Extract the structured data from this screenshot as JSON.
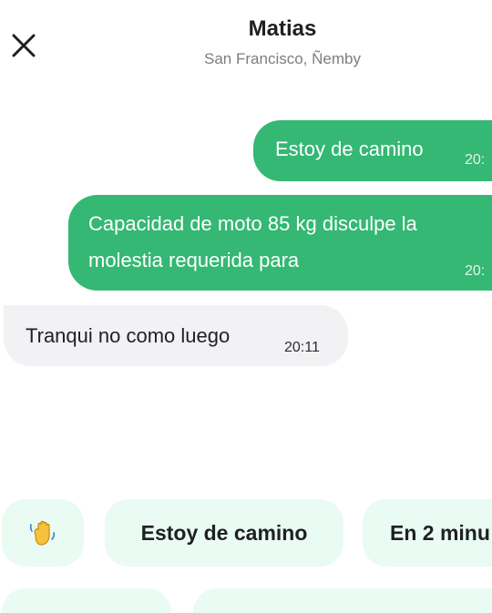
{
  "header": {
    "close_icon": "close-icon",
    "title": "Matias",
    "subtitle": "San Francisco, Ñemby"
  },
  "messages": [
    {
      "direction": "outgoing",
      "text": "Estoy de camino",
      "time": "20:"
    },
    {
      "direction": "outgoing",
      "lines": [
        "Capacidad de moto 85 kg disculpe la",
        "molestia requerida para"
      ],
      "time": "20:"
    },
    {
      "direction": "incoming",
      "text": "Tranqui no como luego",
      "time": "20:11"
    }
  ],
  "quick_replies": [
    {
      "icon": "waving-hand-icon",
      "label": ""
    },
    {
      "label": "Estoy de camino"
    },
    {
      "label": "En 2 minu"
    },
    {
      "label": ""
    },
    {
      "label": ""
    }
  ],
  "colors": {
    "outgoing_bubble": "#34b873",
    "incoming_bubble": "#f2f2f5",
    "chip_background": "#e9fbf3",
    "title_text": "#1f2023",
    "subtitle_text": "#7b7d82"
  }
}
